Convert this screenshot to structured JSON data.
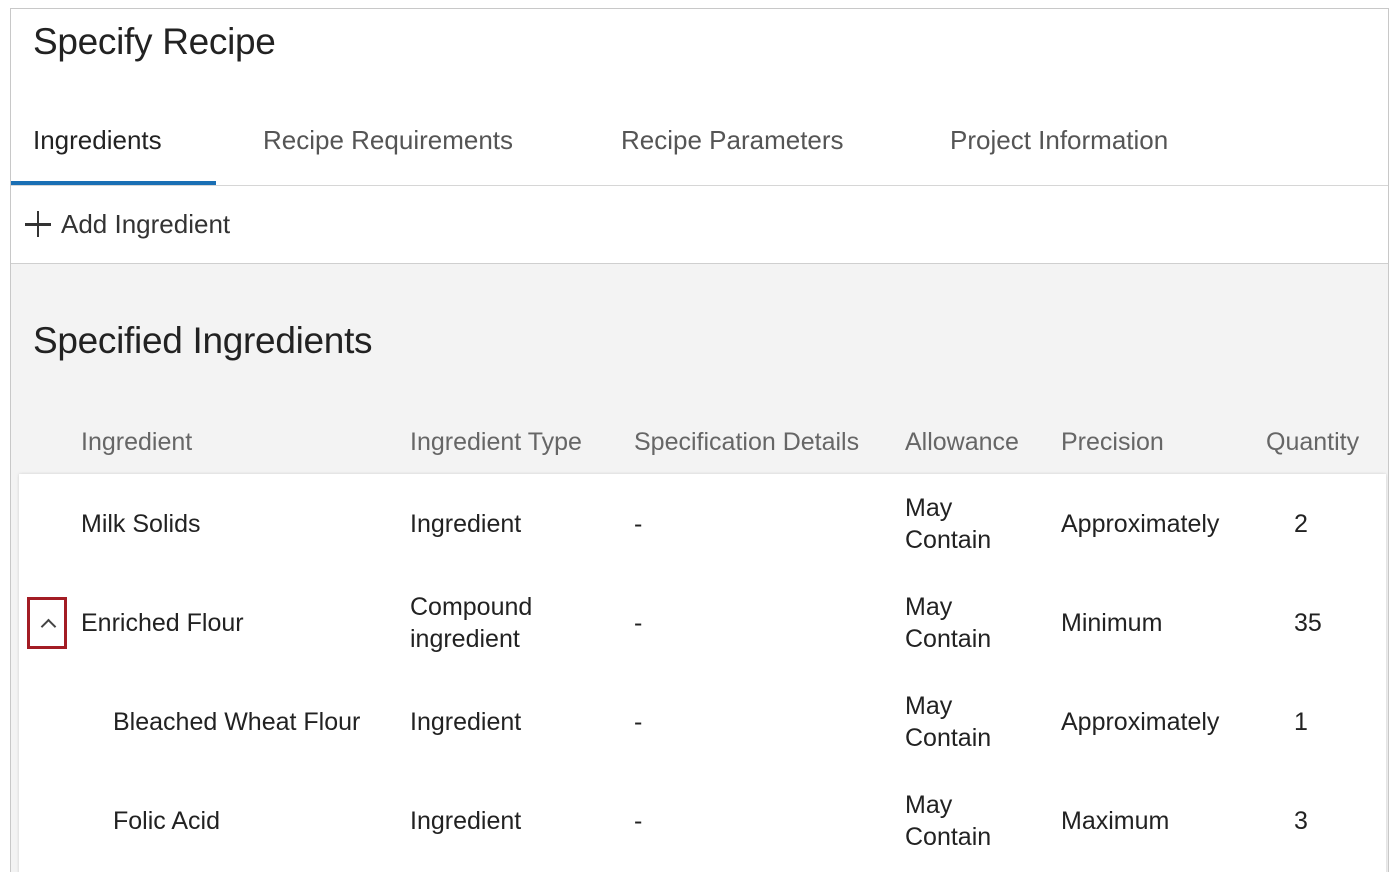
{
  "page": {
    "title": "Specify Recipe"
  },
  "tabs": [
    {
      "label": "Ingredients",
      "active": true
    },
    {
      "label": "Recipe Requirements",
      "active": false
    },
    {
      "label": "Recipe Parameters",
      "active": false
    },
    {
      "label": "Project Information",
      "active": false
    }
  ],
  "toolbar": {
    "add_label": "Add Ingredient",
    "add_icon": "plus-icon"
  },
  "section": {
    "title": "Specified Ingredients"
  },
  "table": {
    "columns": [
      "Ingredient",
      "Ingredient Type",
      "Specification Details",
      "Allowance",
      "Precision",
      "Quantity"
    ],
    "rows": [
      {
        "ingredient": "Milk Solids",
        "type": "Ingredient",
        "details": "-",
        "allowance": "May Contain",
        "precision": "Approximately",
        "quantity": "2",
        "expandable": false,
        "child": false
      },
      {
        "ingredient": "Enriched Flour",
        "type": "Compound ingredient",
        "details": "-",
        "allowance": "May Contain",
        "precision": "Minimum",
        "quantity": "35",
        "expandable": true,
        "expanded": true,
        "child": false
      },
      {
        "ingredient": "Bleached Wheat Flour",
        "type": "Ingredient",
        "details": "-",
        "allowance": "May Contain",
        "precision": "Approximately",
        "quantity": "1",
        "expandable": false,
        "child": true
      },
      {
        "ingredient": "Folic Acid",
        "type": "Ingredient",
        "details": "-",
        "allowance": "May Contain",
        "precision": "Maximum",
        "quantity": "3",
        "expandable": false,
        "child": true
      }
    ]
  },
  "colors": {
    "accent": "#1a6fb4",
    "focus_outline": "#a31c24"
  }
}
